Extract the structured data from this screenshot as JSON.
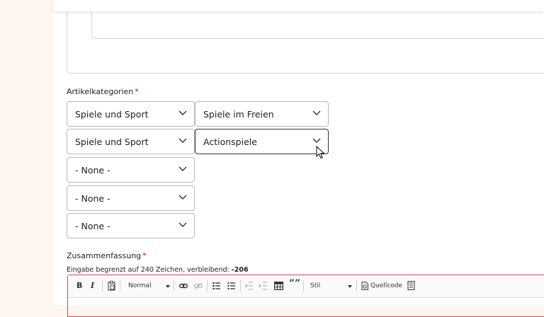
{
  "categories": {
    "label": "Artikelkategorien",
    "required_mark": "*",
    "rows": [
      {
        "main": "Spiele und Sport",
        "sub": "Spiele im Freien"
      },
      {
        "main": "Spiele und Sport",
        "sub": "Actionspiele"
      },
      {
        "main": "- None -"
      },
      {
        "main": "- None -"
      },
      {
        "main": "- None -"
      }
    ]
  },
  "summary": {
    "label": "Zusammenfassung",
    "required_mark": "*",
    "hint_prefix": "Eingabe begrenzt auf 240 Zeichen, verbleibend:",
    "hint_remaining": "-206"
  },
  "toolbar": {
    "bold": "B",
    "italic": "I",
    "format_value": "Normal",
    "quote": "””",
    "style_value": "Stil",
    "source_label": "Quellcode"
  },
  "icons": {
    "chevron": "chevron-down-icon",
    "paste": "paste-icon",
    "link": "link-icon",
    "unlink": "unlink-icon",
    "bullets": "bulleted-list-icon",
    "numbers": "numbered-list-icon",
    "outdent": "outdent-icon",
    "indent": "indent-icon",
    "table": "table-icon",
    "source": "source-icon",
    "templates": "templates-icon"
  },
  "colors": {
    "required": "#d0021b",
    "error_border": "#d04b4b",
    "page_bg": "#fdf6f1"
  }
}
